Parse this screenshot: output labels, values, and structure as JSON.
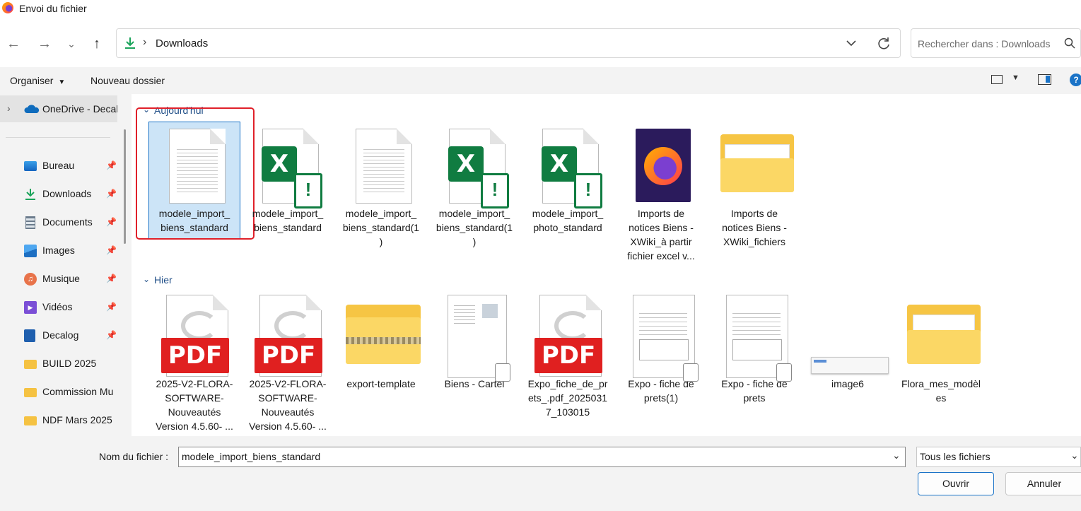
{
  "window": {
    "title": "Envoi du fichier"
  },
  "nav": {
    "path": "Downloads",
    "search_placeholder": "Rechercher dans : Downloads"
  },
  "toolbar": {
    "organiser": "Organiser",
    "new_folder": "Nouveau dossier"
  },
  "sidebar": {
    "onedrive": "OneDrive - Decalog",
    "items": [
      {
        "label": "Bureau",
        "icon": "desktop-icon",
        "pinned": true
      },
      {
        "label": "Downloads",
        "icon": "download-icon",
        "pinned": true
      },
      {
        "label": "Documents",
        "icon": "document-icon",
        "pinned": true
      },
      {
        "label": "Images",
        "icon": "images-icon",
        "pinned": true
      },
      {
        "label": "Musique",
        "icon": "music-icon",
        "pinned": true
      },
      {
        "label": "Vidéos",
        "icon": "video-icon",
        "pinned": true
      },
      {
        "label": "Decalog",
        "icon": "building-icon",
        "pinned": true
      },
      {
        "label": "BUILD 2025",
        "icon": "folder-icon",
        "pinned": false
      },
      {
        "label": "Commission Mu",
        "icon": "folder-icon",
        "pinned": false
      },
      {
        "label": "NDF Mars 2025",
        "icon": "folder-icon",
        "pinned": false
      }
    ]
  },
  "groups": [
    {
      "title": "Aujourd'hui",
      "files": [
        {
          "name": "modele_import_biens_standard",
          "label_lines": [
            "modele_import_",
            "biens_standard"
          ],
          "type": "text",
          "selected": true
        },
        {
          "name": "modele_import_biens_standard",
          "label_lines": [
            "modele_import_",
            "biens_standard"
          ],
          "type": "excel-warning"
        },
        {
          "name": "modele_import_biens_standard(1)",
          "label_lines": [
            "modele_import_",
            "biens_standard(1",
            ")"
          ],
          "type": "text"
        },
        {
          "name": "modele_import_biens_standard(1)",
          "label_lines": [
            "modele_import_",
            "biens_standard(1",
            ")"
          ],
          "type": "excel-warning"
        },
        {
          "name": "modele_import_photo_standard",
          "label_lines": [
            "modele_import_",
            "photo_standard"
          ],
          "type": "excel-warning"
        },
        {
          "name": "Imports de notices Biens - XWiki_à partir fichier excel v...",
          "label_lines": [
            "Imports de",
            "notices Biens -",
            "XWiki_à partir",
            "fichier excel v..."
          ],
          "type": "firefox"
        },
        {
          "name": "Imports de notices Biens - XWiki_fichiers",
          "label_lines": [
            "Imports de",
            "notices Biens -",
            "XWiki_fichiers"
          ],
          "type": "folder"
        }
      ]
    },
    {
      "title": "Hier",
      "files": [
        {
          "name": "2025-V2-FLORA-SOFTWARE-Nouveautés Version 4.5.60- ...",
          "label_lines": [
            "2025-V2-FLORA-",
            "SOFTWARE-",
            "Nouveautés",
            "Version 4.5.60- ..."
          ],
          "type": "pdf"
        },
        {
          "name": "2025-V2-FLORA-SOFTWARE-Nouveautés Version 4.5.60- ...",
          "label_lines": [
            "2025-V2-FLORA-",
            "SOFTWARE-",
            "Nouveautés",
            "Version 4.5.60- ..."
          ],
          "type": "pdf"
        },
        {
          "name": "export-template",
          "label_lines": [
            "export-template"
          ],
          "type": "zip"
        },
        {
          "name": "Biens - Cartel",
          "label_lines": [
            "Biens - Cartel"
          ],
          "type": "doc-image"
        },
        {
          "name": "Expo_fiche_de_prets_.pdf_20250317_103015",
          "label_lines": [
            "Expo_fiche_de_pr",
            "ets_.pdf_2025031",
            "7_103015"
          ],
          "type": "pdf"
        },
        {
          "name": "Expo - fiche de prets(1)",
          "label_lines": [
            "Expo - fiche de",
            "prets(1)"
          ],
          "type": "doc-form"
        },
        {
          "name": "Expo - fiche de prets",
          "label_lines": [
            "Expo - fiche de",
            "prets"
          ],
          "type": "doc-form"
        },
        {
          "name": "image6",
          "label_lines": [
            "image6"
          ],
          "type": "image"
        },
        {
          "name": "Flora_mes_modèles",
          "label_lines": [
            "Flora_mes_modèl",
            "es"
          ],
          "type": "folder"
        }
      ]
    }
  ],
  "footer": {
    "filename_label": "Nom du fichier :",
    "filename_value": "modele_import_biens_standard",
    "filetype_value": "Tous les fichiers",
    "open_label": "Ouvrir",
    "cancel_label": "Annuler"
  },
  "colors": {
    "accent": "#1a73c7",
    "selection": "#cce4f7",
    "annotation_red": "#e0202a",
    "excel_green": "#107c41",
    "pdf_red": "#e02020"
  }
}
